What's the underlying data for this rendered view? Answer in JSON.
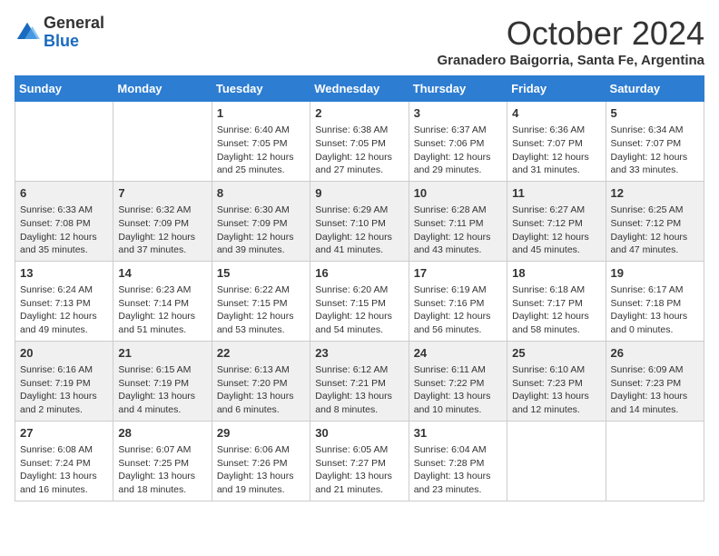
{
  "logo": {
    "general": "General",
    "blue": "Blue"
  },
  "title": "October 2024",
  "subtitle": "Granadero Baigorria, Santa Fe, Argentina",
  "days_of_week": [
    "Sunday",
    "Monday",
    "Tuesday",
    "Wednesday",
    "Thursday",
    "Friday",
    "Saturday"
  ],
  "weeks": [
    [
      {
        "day": "",
        "sunrise": "",
        "sunset": "",
        "daylight": ""
      },
      {
        "day": "",
        "sunrise": "",
        "sunset": "",
        "daylight": ""
      },
      {
        "day": "1",
        "sunrise": "Sunrise: 6:40 AM",
        "sunset": "Sunset: 7:05 PM",
        "daylight": "Daylight: 12 hours and 25 minutes."
      },
      {
        "day": "2",
        "sunrise": "Sunrise: 6:38 AM",
        "sunset": "Sunset: 7:05 PM",
        "daylight": "Daylight: 12 hours and 27 minutes."
      },
      {
        "day": "3",
        "sunrise": "Sunrise: 6:37 AM",
        "sunset": "Sunset: 7:06 PM",
        "daylight": "Daylight: 12 hours and 29 minutes."
      },
      {
        "day": "4",
        "sunrise": "Sunrise: 6:36 AM",
        "sunset": "Sunset: 7:07 PM",
        "daylight": "Daylight: 12 hours and 31 minutes."
      },
      {
        "day": "5",
        "sunrise": "Sunrise: 6:34 AM",
        "sunset": "Sunset: 7:07 PM",
        "daylight": "Daylight: 12 hours and 33 minutes."
      }
    ],
    [
      {
        "day": "6",
        "sunrise": "Sunrise: 6:33 AM",
        "sunset": "Sunset: 7:08 PM",
        "daylight": "Daylight: 12 hours and 35 minutes."
      },
      {
        "day": "7",
        "sunrise": "Sunrise: 6:32 AM",
        "sunset": "Sunset: 7:09 PM",
        "daylight": "Daylight: 12 hours and 37 minutes."
      },
      {
        "day": "8",
        "sunrise": "Sunrise: 6:30 AM",
        "sunset": "Sunset: 7:09 PM",
        "daylight": "Daylight: 12 hours and 39 minutes."
      },
      {
        "day": "9",
        "sunrise": "Sunrise: 6:29 AM",
        "sunset": "Sunset: 7:10 PM",
        "daylight": "Daylight: 12 hours and 41 minutes."
      },
      {
        "day": "10",
        "sunrise": "Sunrise: 6:28 AM",
        "sunset": "Sunset: 7:11 PM",
        "daylight": "Daylight: 12 hours and 43 minutes."
      },
      {
        "day": "11",
        "sunrise": "Sunrise: 6:27 AM",
        "sunset": "Sunset: 7:12 PM",
        "daylight": "Daylight: 12 hours and 45 minutes."
      },
      {
        "day": "12",
        "sunrise": "Sunrise: 6:25 AM",
        "sunset": "Sunset: 7:12 PM",
        "daylight": "Daylight: 12 hours and 47 minutes."
      }
    ],
    [
      {
        "day": "13",
        "sunrise": "Sunrise: 6:24 AM",
        "sunset": "Sunset: 7:13 PM",
        "daylight": "Daylight: 12 hours and 49 minutes."
      },
      {
        "day": "14",
        "sunrise": "Sunrise: 6:23 AM",
        "sunset": "Sunset: 7:14 PM",
        "daylight": "Daylight: 12 hours and 51 minutes."
      },
      {
        "day": "15",
        "sunrise": "Sunrise: 6:22 AM",
        "sunset": "Sunset: 7:15 PM",
        "daylight": "Daylight: 12 hours and 53 minutes."
      },
      {
        "day": "16",
        "sunrise": "Sunrise: 6:20 AM",
        "sunset": "Sunset: 7:15 PM",
        "daylight": "Daylight: 12 hours and 54 minutes."
      },
      {
        "day": "17",
        "sunrise": "Sunrise: 6:19 AM",
        "sunset": "Sunset: 7:16 PM",
        "daylight": "Daylight: 12 hours and 56 minutes."
      },
      {
        "day": "18",
        "sunrise": "Sunrise: 6:18 AM",
        "sunset": "Sunset: 7:17 PM",
        "daylight": "Daylight: 12 hours and 58 minutes."
      },
      {
        "day": "19",
        "sunrise": "Sunrise: 6:17 AM",
        "sunset": "Sunset: 7:18 PM",
        "daylight": "Daylight: 13 hours and 0 minutes."
      }
    ],
    [
      {
        "day": "20",
        "sunrise": "Sunrise: 6:16 AM",
        "sunset": "Sunset: 7:19 PM",
        "daylight": "Daylight: 13 hours and 2 minutes."
      },
      {
        "day": "21",
        "sunrise": "Sunrise: 6:15 AM",
        "sunset": "Sunset: 7:19 PM",
        "daylight": "Daylight: 13 hours and 4 minutes."
      },
      {
        "day": "22",
        "sunrise": "Sunrise: 6:13 AM",
        "sunset": "Sunset: 7:20 PM",
        "daylight": "Daylight: 13 hours and 6 minutes."
      },
      {
        "day": "23",
        "sunrise": "Sunrise: 6:12 AM",
        "sunset": "Sunset: 7:21 PM",
        "daylight": "Daylight: 13 hours and 8 minutes."
      },
      {
        "day": "24",
        "sunrise": "Sunrise: 6:11 AM",
        "sunset": "Sunset: 7:22 PM",
        "daylight": "Daylight: 13 hours and 10 minutes."
      },
      {
        "day": "25",
        "sunrise": "Sunrise: 6:10 AM",
        "sunset": "Sunset: 7:23 PM",
        "daylight": "Daylight: 13 hours and 12 minutes."
      },
      {
        "day": "26",
        "sunrise": "Sunrise: 6:09 AM",
        "sunset": "Sunset: 7:23 PM",
        "daylight": "Daylight: 13 hours and 14 minutes."
      }
    ],
    [
      {
        "day": "27",
        "sunrise": "Sunrise: 6:08 AM",
        "sunset": "Sunset: 7:24 PM",
        "daylight": "Daylight: 13 hours and 16 minutes."
      },
      {
        "day": "28",
        "sunrise": "Sunrise: 6:07 AM",
        "sunset": "Sunset: 7:25 PM",
        "daylight": "Daylight: 13 hours and 18 minutes."
      },
      {
        "day": "29",
        "sunrise": "Sunrise: 6:06 AM",
        "sunset": "Sunset: 7:26 PM",
        "daylight": "Daylight: 13 hours and 19 minutes."
      },
      {
        "day": "30",
        "sunrise": "Sunrise: 6:05 AM",
        "sunset": "Sunset: 7:27 PM",
        "daylight": "Daylight: 13 hours and 21 minutes."
      },
      {
        "day": "31",
        "sunrise": "Sunrise: 6:04 AM",
        "sunset": "Sunset: 7:28 PM",
        "daylight": "Daylight: 13 hours and 23 minutes."
      },
      {
        "day": "",
        "sunrise": "",
        "sunset": "",
        "daylight": ""
      },
      {
        "day": "",
        "sunrise": "",
        "sunset": "",
        "daylight": ""
      }
    ]
  ]
}
